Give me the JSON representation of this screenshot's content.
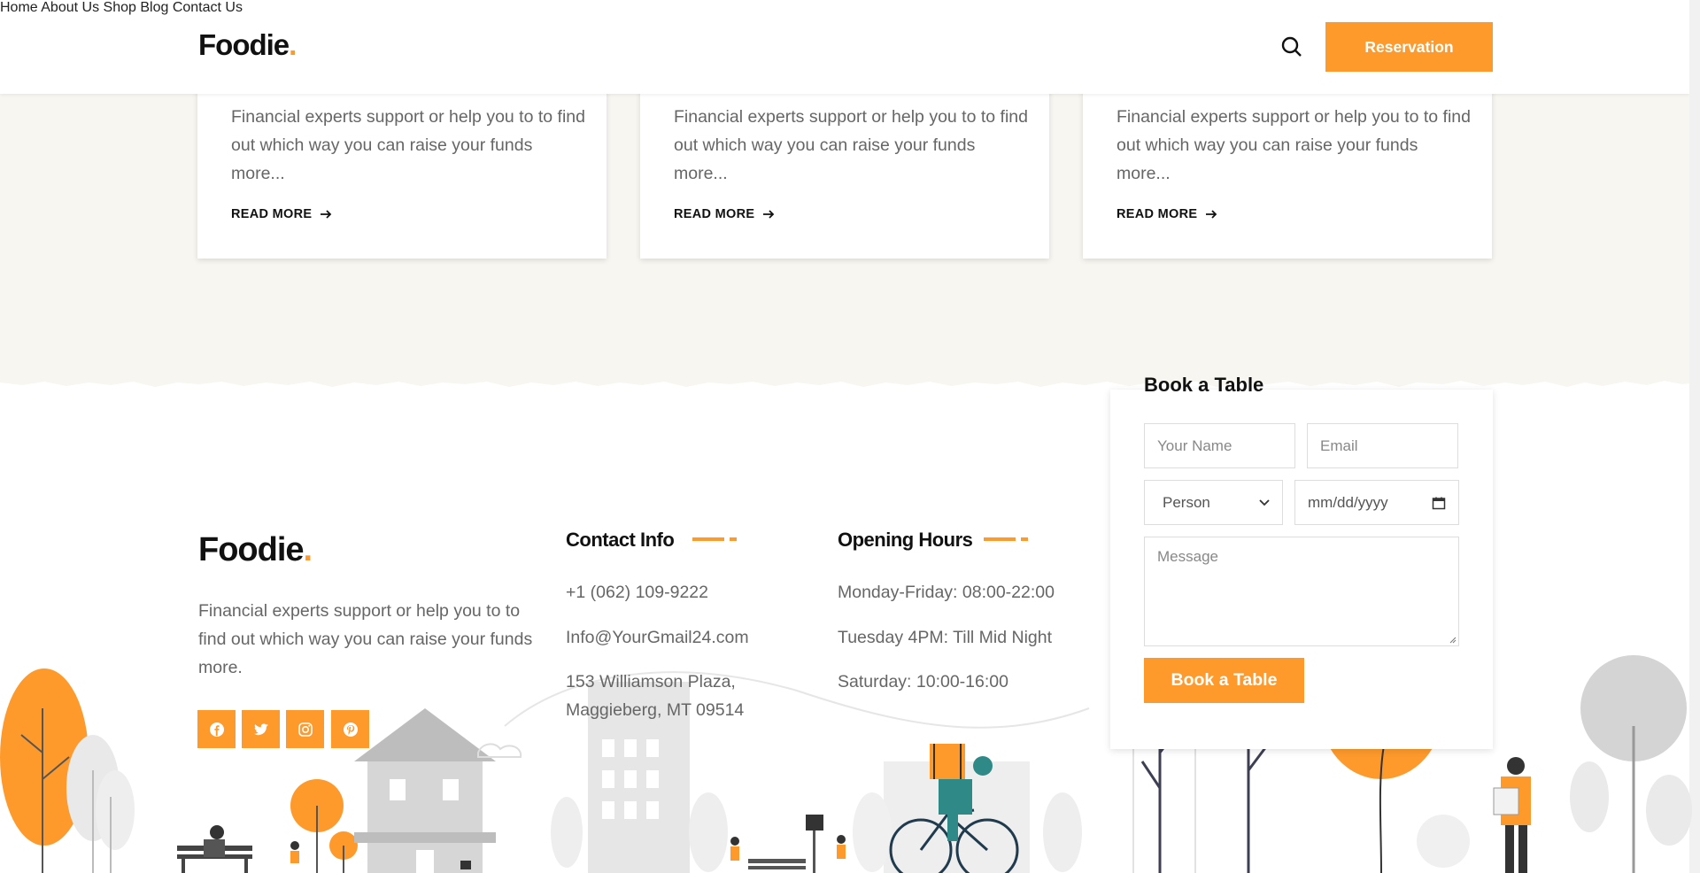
{
  "header": {
    "logo": "Foodie",
    "logo_dot": ".",
    "nav": [
      "Home",
      "About Us",
      "Shop",
      "Blog",
      "Contact Us"
    ],
    "reservation_label": "Reservation",
    "search_icon": "search-icon"
  },
  "blog": {
    "cards": [
      {
        "excerpt": "Financial experts support or help you to to find out which way you can raise your funds more...",
        "read_more": "READ MORE"
      },
      {
        "excerpt": "Financial experts support or help you to to find out which way you can raise your funds more...",
        "read_more": "READ MORE"
      },
      {
        "excerpt": "Financial experts support or help you to to find out which way you can raise your funds more...",
        "read_more": "READ MORE"
      }
    ]
  },
  "footer": {
    "logo": "Foodie",
    "logo_dot": ".",
    "about": "Financial experts support or help you to to find out which way you can raise your funds more.",
    "social": [
      "facebook-icon",
      "twitter-icon",
      "instagram-icon",
      "pinterest-icon"
    ],
    "contact": {
      "title": "Contact Info",
      "phone": "+1 (062) 109-9222",
      "email": "Info@YourGmail24.com",
      "address_line1": "153 Williamson Plaza,",
      "address_line2": "Maggieberg, MT 09514"
    },
    "hours": {
      "title": "Opening Hours",
      "line1": "Monday-Friday: 08:00-22:00",
      "line2": "Tuesday 4PM: Till Mid Night",
      "line3": "Saturday: 10:00-16:00"
    }
  },
  "booking": {
    "title": "Book a Table",
    "name_placeholder": "Your Name",
    "email_placeholder": "Email",
    "person_selected": "Person",
    "date_placeholder": "mm/dd/yyyy",
    "message_placeholder": "Message",
    "submit_label": "Book a Table"
  },
  "colors": {
    "accent": "#fe9a2c",
    "cream": "#f8f6f1",
    "text_dark": "#111111",
    "text_muted": "#666666"
  }
}
